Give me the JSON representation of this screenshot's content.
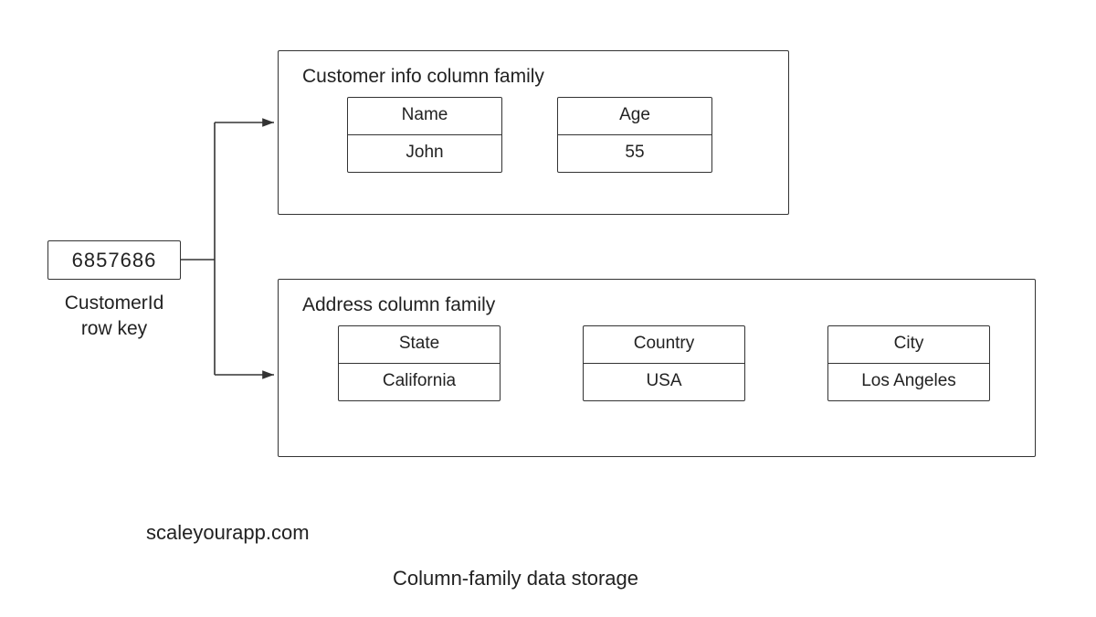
{
  "rowkey": {
    "value": "6857686",
    "label_line1": "CustomerId",
    "label_line2": "row key"
  },
  "family1": {
    "title": "Customer info column family",
    "columns": [
      {
        "name": "Name",
        "value": "John"
      },
      {
        "name": "Age",
        "value": "55"
      }
    ]
  },
  "family2": {
    "title": "Address column family",
    "columns": [
      {
        "name": "State",
        "value": "California"
      },
      {
        "name": "Country",
        "value": "USA"
      },
      {
        "name": "City",
        "value": "Los Angeles"
      }
    ]
  },
  "attribution": "scaleyourapp.com",
  "caption": "Column-family data storage"
}
